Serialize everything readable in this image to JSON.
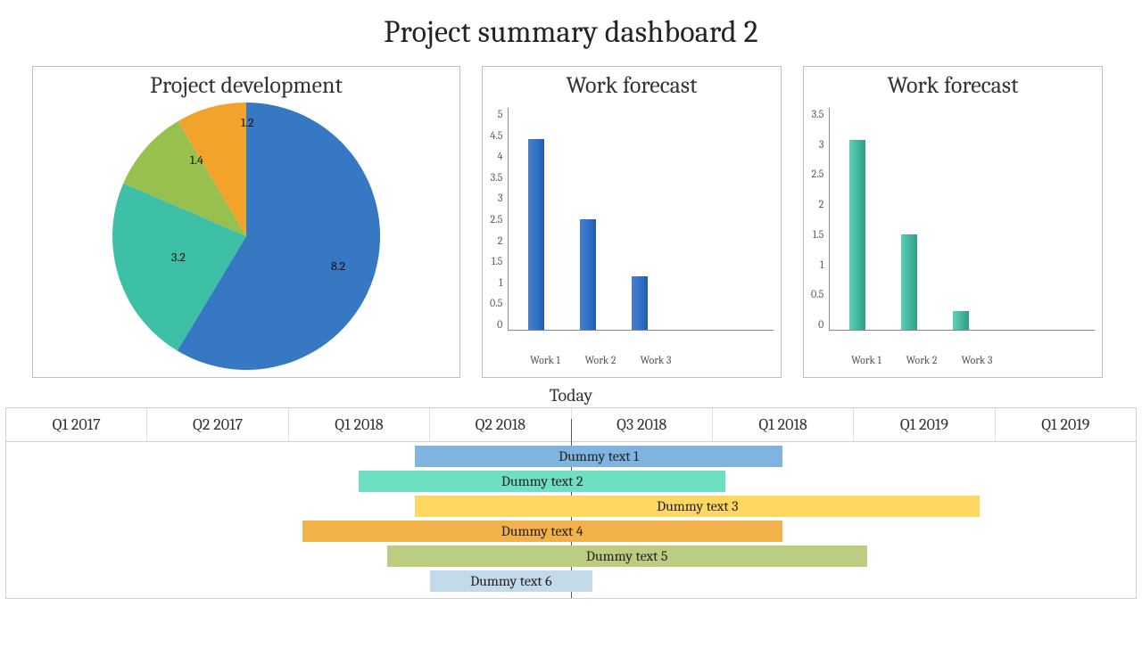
{
  "title": "Project summary dashboard 2",
  "pie": {
    "title": "Project development",
    "labels": {
      "a": "8.2",
      "b": "3.2",
      "c": "1.4",
      "d": "1.2"
    }
  },
  "bar1": {
    "title": "Work forecast",
    "ticks": [
      "5",
      "4.5",
      "4",
      "3.5",
      "3",
      "2.5",
      "2",
      "1.5",
      "1",
      "0.5",
      "0"
    ],
    "x": {
      "a": "Work 1",
      "b": "Work 2",
      "c": "Work 3"
    }
  },
  "bar2": {
    "title": "Work forecast",
    "ticks": [
      "3.5",
      "3",
      "2.5",
      "2",
      "1.5",
      "1",
      "0.5",
      "0"
    ],
    "x": {
      "a": "Work 1",
      "b": "Work 2",
      "c": "Work 3"
    }
  },
  "gantt": {
    "today": "Today",
    "quarters": {
      "q1": "Q1 2017",
      "q2": "Q2 2017",
      "q3": "Q1 2018",
      "q4": "Q2 2018",
      "q5": "Q3 2018",
      "q6": "Q1 2018",
      "q7": "Q1 2019",
      "q8": "Q1 2019"
    },
    "bars": {
      "t1": "Dummy text 1",
      "t2": "Dummy text 2",
      "t3": "Dummy text 3",
      "t4": "Dummy text 4",
      "t5": "Dummy text 5",
      "t6": "Dummy text 6"
    }
  },
  "chart_data": [
    {
      "type": "pie",
      "title": "Project development",
      "series": [
        {
          "name": "",
          "values": [
            8.2,
            3.2,
            1.4,
            1.2
          ],
          "labels": [
            "8.2",
            "3.2",
            "1.4",
            "1.2"
          ],
          "colors": [
            "#3678c2",
            "#3ec0a7",
            "#97c04e",
            "#f2a42a"
          ]
        }
      ]
    },
    {
      "type": "bar",
      "title": "Work forecast",
      "categories": [
        "Work 1",
        "Work 2",
        "Work 3"
      ],
      "values": [
        4.3,
        2.5,
        1.2
      ],
      "ylim": [
        0,
        5
      ],
      "ylabel": ""
    },
    {
      "type": "bar",
      "title": "Work forecast",
      "categories": [
        "Work 1",
        "Work 2",
        "Work 3"
      ],
      "values": [
        3.0,
        1.5,
        0.3
      ],
      "ylim": [
        0,
        3.5
      ],
      "ylabel": ""
    },
    {
      "type": "gantt",
      "title": "",
      "today_marker": "Today",
      "columns": [
        "Q1 2017",
        "Q2 2017",
        "Q1 2018",
        "Q2 2018",
        "Q3 2018",
        "Q1 2018",
        "Q1 2019",
        "Q1 2019"
      ],
      "tasks": [
        {
          "label": "Dummy text 1",
          "start_col_frac": 2.9,
          "end_col_frac": 5.5,
          "color": "#7eb4df"
        },
        {
          "label": "Dummy text 2",
          "start_col_frac": 2.5,
          "end_col_frac": 5.1,
          "color": "#6edfc2"
        },
        {
          "label": "Dummy text 3",
          "start_col_frac": 2.9,
          "end_col_frac": 6.9,
          "color": "#ffd861"
        },
        {
          "label": "Dummy text 4",
          "start_col_frac": 2.1,
          "end_col_frac": 5.5,
          "color": "#f3b14a"
        },
        {
          "label": "Dummy text 5",
          "start_col_frac": 2.7,
          "end_col_frac": 6.1,
          "color": "#bccd82"
        },
        {
          "label": "Dummy text 6",
          "start_col_frac": 3.0,
          "end_col_frac": 4.15,
          "color": "#c3daea"
        }
      ]
    }
  ]
}
